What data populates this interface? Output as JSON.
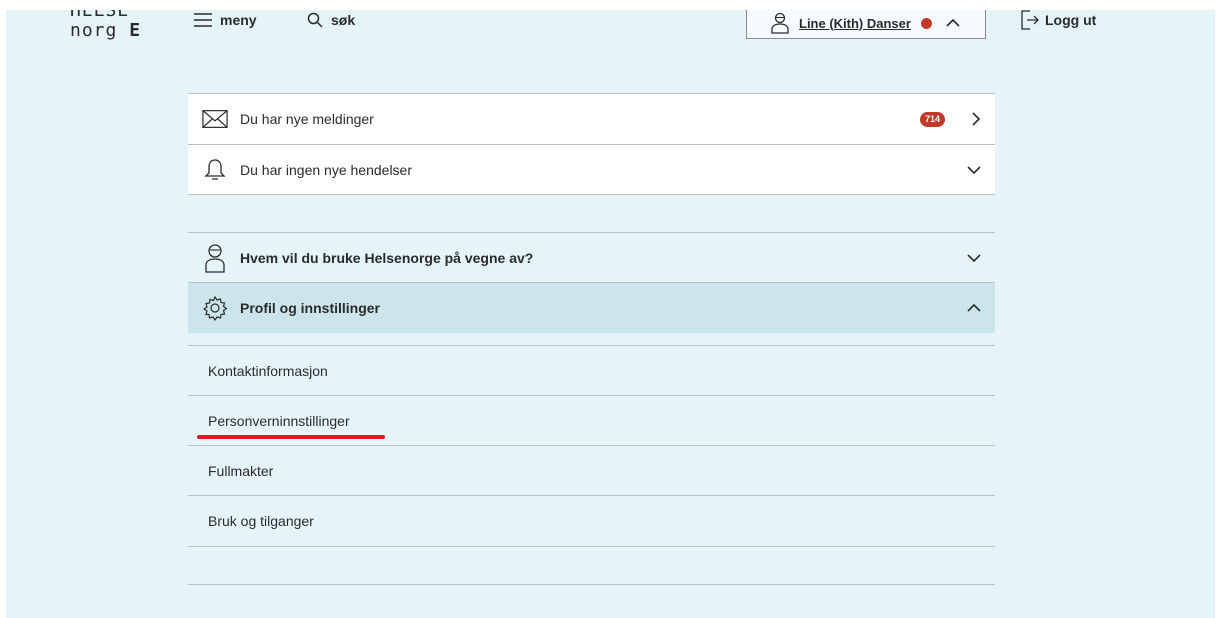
{
  "header": {
    "logo_line1": "HELSE",
    "logo_line2_a": "norg",
    "logo_line2_b": "E",
    "menu_label": "meny",
    "search_label": "søk",
    "user_name": "Line (Kith) Danser",
    "logout_label": "Logg ut"
  },
  "notifications": {
    "messages": {
      "label": "Du har nye meldinger",
      "badge": "714"
    },
    "events": {
      "label": "Du har ingen nye hendelser"
    }
  },
  "sections": {
    "represent": {
      "label": "Hvem vil du bruke Helsenorge på vegne av?"
    },
    "profile": {
      "label": "Profil og innstillinger",
      "items": [
        "Kontaktinformasjon",
        "Personverninnstillinger",
        "Fullmakter",
        "Bruk og tilganger"
      ]
    }
  },
  "colors": {
    "background": "#e5f4f8",
    "selected": "#cce5ec",
    "badge": "#c0392b",
    "annotation": "#e0191f"
  }
}
